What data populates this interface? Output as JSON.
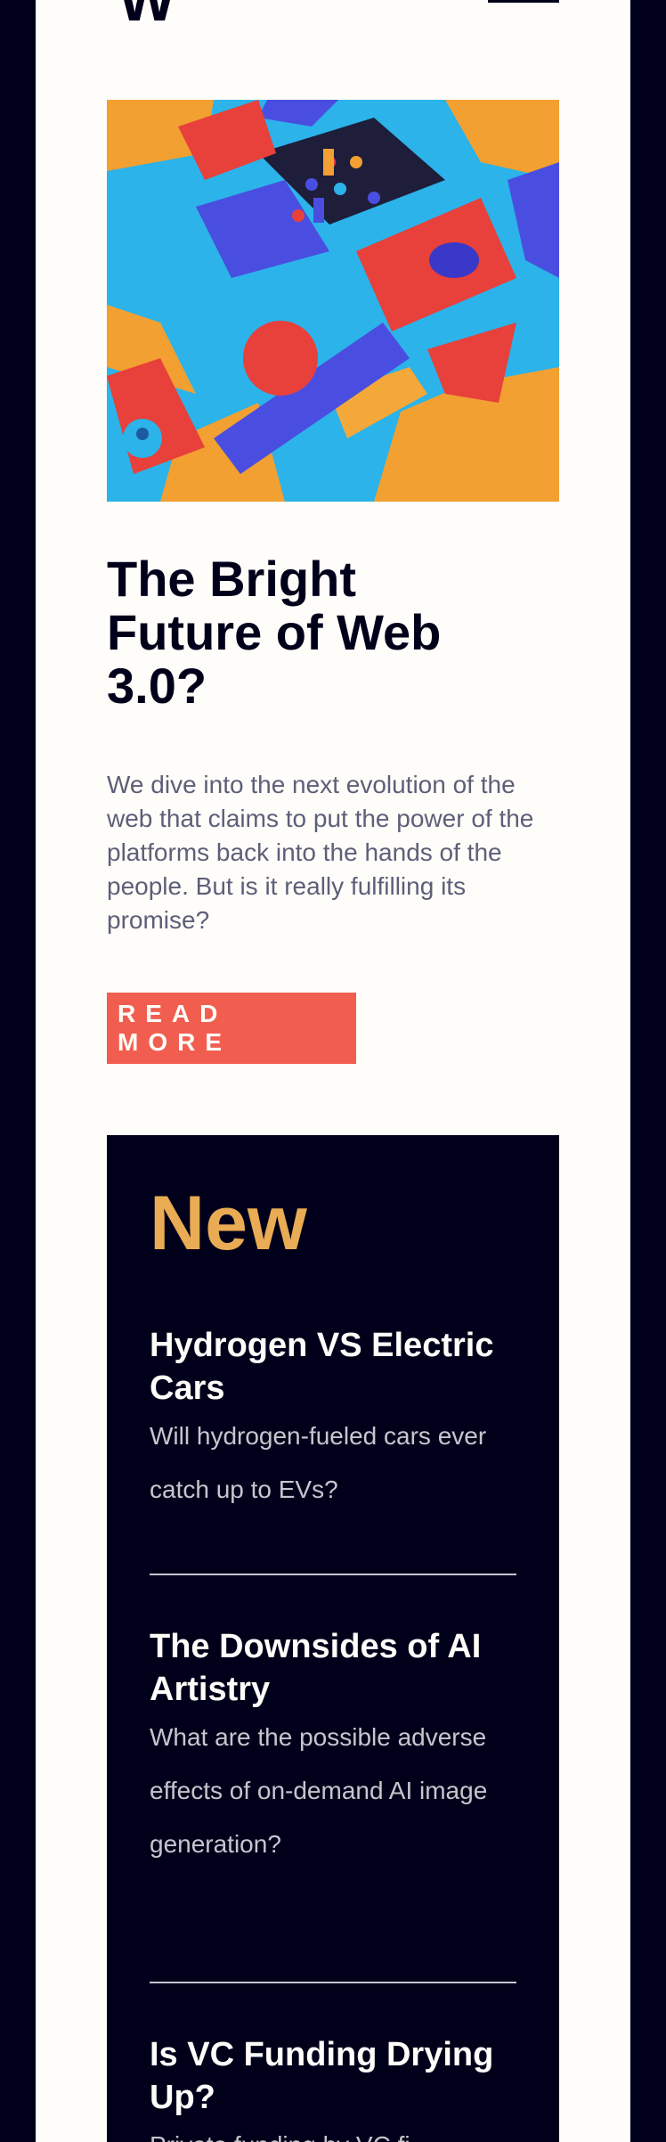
{
  "header": {
    "logo_text": "W.",
    "menu_icon": "hamburger-menu-icon"
  },
  "hero": {
    "image_icon": "abstract-3d-shapes-illustration",
    "title": "The Bright Future of Web 3.0?",
    "description": "We dive into the next evolution of the web that claims to put the power of the platforms back into the hands of the people. But is it really fulfilling its promise?",
    "cta_label": "READ MORE"
  },
  "new_section": {
    "heading": "New",
    "items": [
      {
        "title": "Hydrogen VS Electric Cars",
        "description": "Will hydrogen-fueled cars ever catch up to EVs?"
      },
      {
        "title": "The Downsides of AI Artistry",
        "description": "What are the possible adverse effects of on-demand AI image generation?"
      },
      {
        "title": "Is VC Funding Drying Up?",
        "description": "Private funding by VC fi"
      }
    ]
  },
  "colors": {
    "background": "#00001a",
    "page": "#fffdf9",
    "accent_red": "#f15e50",
    "accent_orange": "#e9ab53",
    "text_muted": "#5d5f79"
  }
}
